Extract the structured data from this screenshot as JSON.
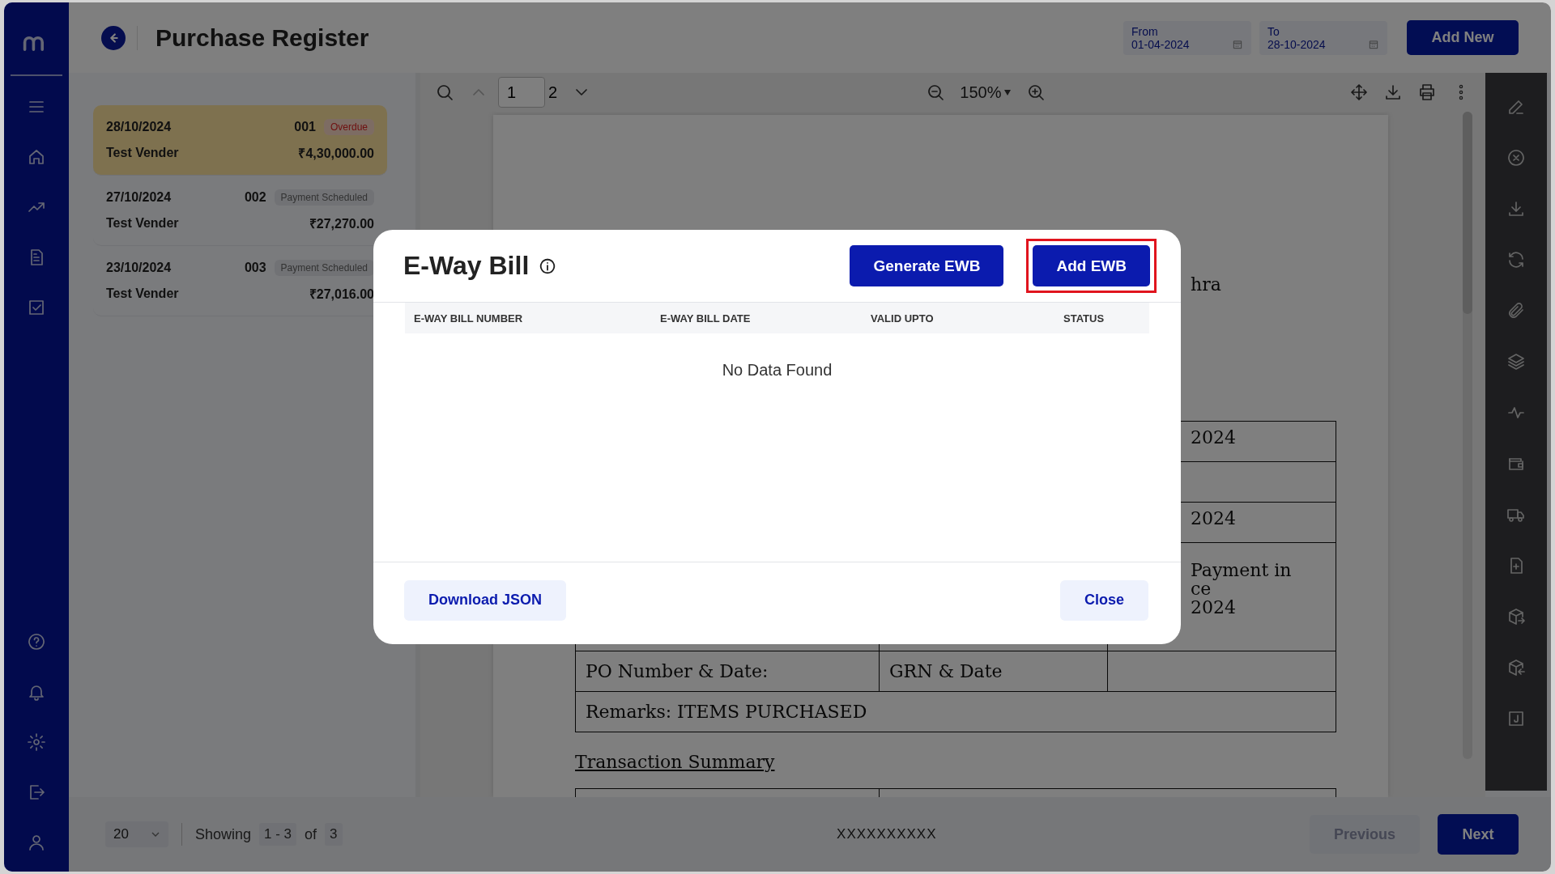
{
  "header": {
    "title": "Purchase Register",
    "from": {
      "label": "From",
      "value": "01-04-2024"
    },
    "to": {
      "label": "To",
      "value": "28-10-2024"
    },
    "add_button": "Add New"
  },
  "invoices": [
    {
      "date": "28/10/2024",
      "number": "001",
      "status": "Overdue",
      "kind": "overdue",
      "vendor": "Test Vender",
      "amount": "₹4,30,000.00",
      "selected": true
    },
    {
      "date": "27/10/2024",
      "number": "002",
      "status": "Payment Scheduled",
      "kind": "scheduled",
      "vendor": "Test Vender",
      "amount": "₹27,270.00",
      "selected": false
    },
    {
      "date": "23/10/2024",
      "number": "003",
      "status": "Payment Scheduled",
      "kind": "scheduled",
      "vendor": "Test Vender",
      "amount": "₹27,016.00",
      "selected": false
    }
  ],
  "viewer": {
    "page_input": "1",
    "page_count": "2",
    "zoom": "150%",
    "document": {
      "fragment": "hra",
      "rows": [
        {
          "kind": "right",
          "lines": [
            "2024"
          ]
        },
        {
          "kind": "blank"
        },
        {
          "kind": "right",
          "lines": [
            "2024"
          ]
        },
        {
          "kind": "right",
          "lines": [
            "Payment in",
            "ce",
            "2024"
          ]
        },
        {
          "kind": "cells",
          "cells": [
            "PO Number & Date:",
            "GRN & Date"
          ]
        },
        {
          "kind": "full",
          "text": "Remarks: ITEMS PURCHASED"
        }
      ],
      "section_title": "Transaction Summary"
    }
  },
  "modal": {
    "title": "E-Way Bill",
    "actions": [
      {
        "label": "Generate EWB",
        "highlighted": false
      },
      {
        "label": "Add EWB",
        "highlighted": true
      }
    ],
    "columns": [
      "E-WAY BILL NUMBER",
      "E-WAY BILL DATE",
      "VALID UPTO",
      "STATUS"
    ],
    "empty_text": "No Data Found",
    "footer_buttons": [
      "Download JSON",
      "Close"
    ]
  },
  "footer": {
    "page_size": "20",
    "showing": "Showing",
    "range": "1 - 3",
    "of": "of",
    "total": "3",
    "center_text": "XXXXXXXXXX",
    "previous": {
      "label": "Previous",
      "disabled": true
    },
    "next": "Next"
  }
}
